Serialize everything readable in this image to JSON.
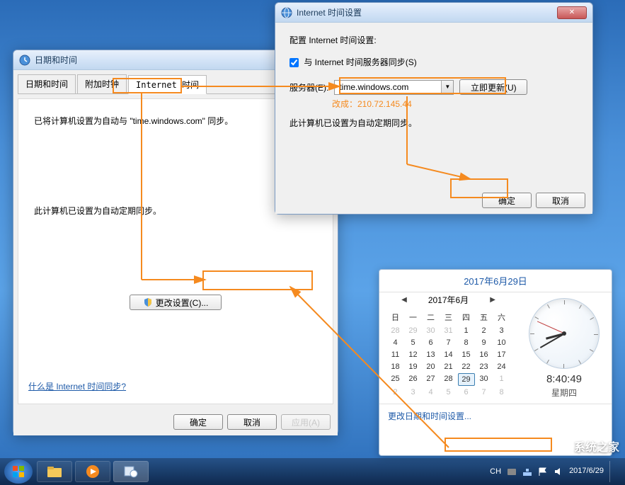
{
  "dlg1": {
    "title": "日期和时间",
    "tabs": [
      "日期和时间",
      "附加时钟",
      "Internet 时间"
    ],
    "activeTab": 2,
    "line1": "已将计算机设置为自动与 \"time.windows.com\" 同步。",
    "line2": "此计算机已设置为自动定期同步。",
    "changeBtn": "更改设置(C)...",
    "helpLink": "什么是 Internet 时间同步?",
    "ok": "确定",
    "cancel": "取消",
    "apply": "应用(A)"
  },
  "dlg2": {
    "title": "Internet 时间设置",
    "heading": "配置 Internet 时间设置:",
    "syncCheck": "与 Internet 时间服务器同步(S)",
    "serverLabel": "服务器(E):",
    "serverValue": "time.windows.com",
    "updateNow": "立即更新(U)",
    "changeTo": "改成：210.72.145.44",
    "status": "此计算机已设置为自动定期同步。",
    "ok": "确定",
    "cancel": "取消"
  },
  "popup": {
    "dateHeader": "2017年6月29日",
    "monthLabel": "2017年6月",
    "dayHeaders": [
      "日",
      "一",
      "二",
      "三",
      "四",
      "五",
      "六"
    ],
    "gridStartDay": 28,
    "prevMonthDays": [
      28,
      29,
      30,
      31
    ],
    "days": [
      1,
      2,
      3,
      4,
      5,
      6,
      7,
      8,
      9,
      10,
      11,
      12,
      13,
      14,
      15,
      16,
      17,
      18,
      19,
      20,
      21,
      22,
      23,
      24,
      25,
      26,
      27,
      28,
      29,
      30
    ],
    "nextMonthDays": [
      1,
      2,
      3,
      4,
      5,
      6,
      7,
      8
    ],
    "today": 29,
    "time": "8:40:49",
    "weekday": "星期四",
    "changeLink": "更改日期和时间设置..."
  },
  "taskbar": {
    "lang": "CH",
    "dateText": "2017/6/29"
  },
  "watermark": "系统之家"
}
